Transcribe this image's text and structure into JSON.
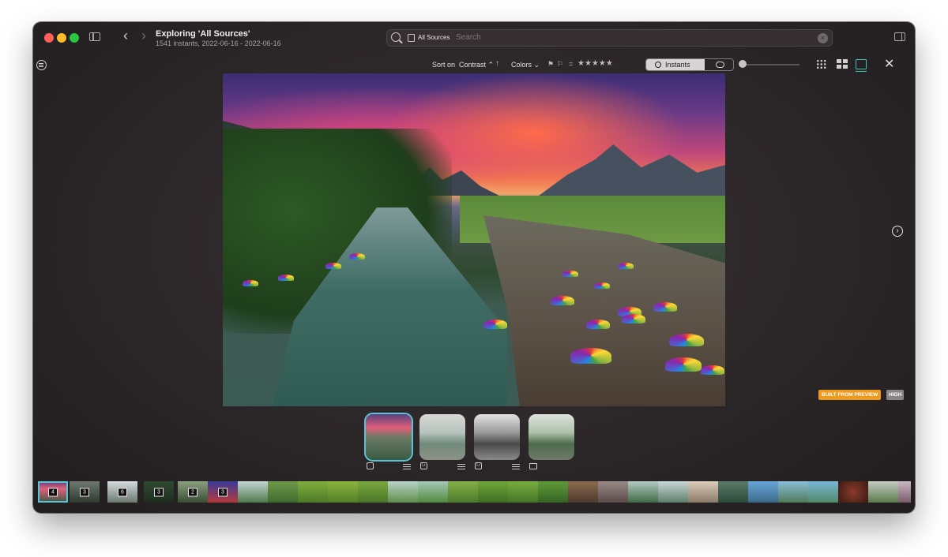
{
  "window": {
    "title": "Exploring 'All Sources'",
    "subtitle": "1541 instants, 2022-06-16 - 2022-06-16"
  },
  "search": {
    "scope": "All Sources",
    "placeholder": "Search"
  },
  "toolbar": {
    "sort_label": "Sort on",
    "sort_value": "Contrast ⌃",
    "sort_direction": "↑",
    "colors_label": "Colors ⌄",
    "rating_operator": "=",
    "rating_stars": "★★★★★",
    "mode_label": "Instants",
    "close_glyph": "✕"
  },
  "icons": {
    "back": "chevron-left-icon",
    "forward": "chevron-right-icon",
    "search": "search-icon",
    "menu": "list-circle-icon",
    "flag": "flag-icon",
    "next": "chevron-circle-right-icon"
  },
  "nav": {
    "back_glyph": "‹",
    "forward_glyph": "›",
    "next_glyph": "›"
  },
  "flags": [
    "⚑",
    "⚐"
  ],
  "badges": {
    "preview": "BUILT FROM PREVIEW",
    "quality": "HIGH"
  },
  "colors": {
    "accent": "#58c3d6",
    "preview_badge": "#ee9a1f",
    "window_bg": "#2b2628"
  },
  "versions": [
    {
      "badge": "",
      "selected": true
    },
    {
      "badge": "Lr",
      "selected": false
    },
    {
      "badge": "Lr",
      "selected": false
    },
    {
      "badge": "folder",
      "selected": false
    }
  ],
  "filmstrip": [
    {
      "count": "4",
      "selected": true
    },
    {
      "count": "3"
    },
    {
      "count": "6"
    },
    {
      "count": "3"
    },
    {
      "count": "2"
    },
    {
      "count": "3"
    }
  ]
}
